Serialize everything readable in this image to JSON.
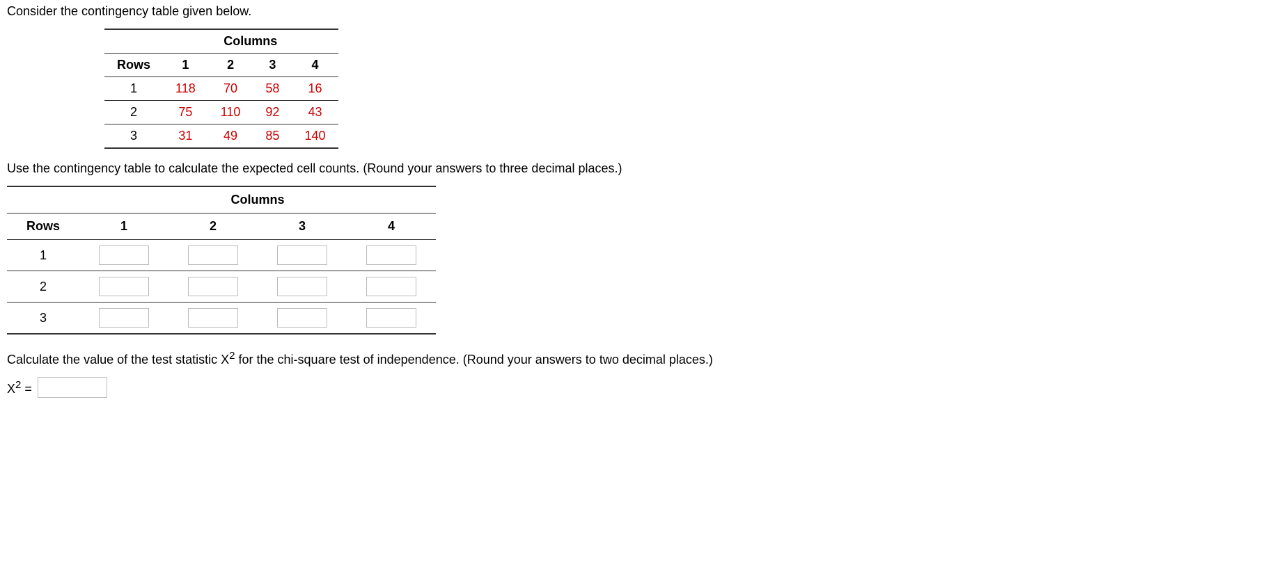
{
  "intro": "Consider the contingency table given below.",
  "table1": {
    "columns_label": "Columns",
    "rows_label": "Rows",
    "col_headers": [
      "1",
      "2",
      "3",
      "4"
    ],
    "rows": [
      {
        "label": "1",
        "cells": [
          "118",
          "70",
          "58",
          "16"
        ]
      },
      {
        "label": "2",
        "cells": [
          "75",
          "110",
          "92",
          "43"
        ]
      },
      {
        "label": "3",
        "cells": [
          "31",
          "49",
          "85",
          "140"
        ]
      }
    ]
  },
  "instruction1": "Use the contingency table to calculate the expected cell counts. (Round your answers to three decimal places.)",
  "table2": {
    "columns_label": "Columns",
    "rows_label": "Rows",
    "col_headers": [
      "1",
      "2",
      "3",
      "4"
    ],
    "row_labels": [
      "1",
      "2",
      "3"
    ]
  },
  "instruction2_pre": "Calculate the value of the test statistic X",
  "instruction2_sup": "2",
  "instruction2_post": " for the chi-square test of independence. (Round your answers to two decimal places.)",
  "x2_label_base": "X",
  "x2_label_sup": "2",
  "x2_label_eq": " = "
}
